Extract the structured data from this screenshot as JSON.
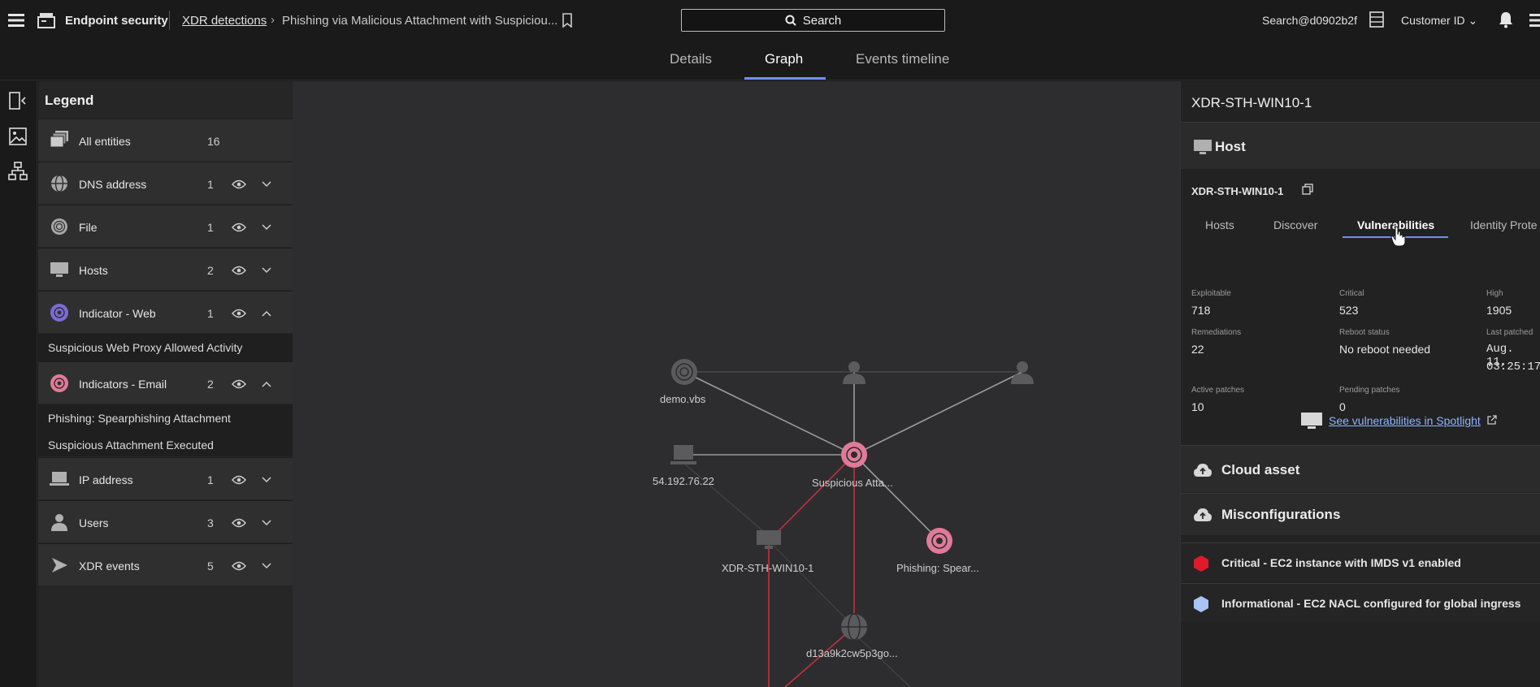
{
  "header": {
    "app_name": "Endpoint security",
    "breadcrumb_link": "XDR detections",
    "breadcrumb_current": "Phishing via Malicious Attachment with Suspiciou...",
    "search_label": "Search",
    "user": "Search@d0902b2f",
    "customer": "Customer ID"
  },
  "tabs": [
    "Details",
    "Graph",
    "Events timeline"
  ],
  "legend": {
    "title": "Legend",
    "all_entities": {
      "label": "All entities",
      "count": "16"
    },
    "rows": [
      {
        "label": "DNS address",
        "count": "1",
        "icon": "globe-icon"
      },
      {
        "label": "File",
        "count": "1",
        "icon": "fingerprint-icon"
      },
      {
        "label": "Hosts",
        "count": "2",
        "icon": "monitor-icon"
      },
      {
        "label": "Indicator - Web",
        "count": "1",
        "icon": "web-indicator-icon"
      },
      {
        "label": "Indicators - Email",
        "count": "2",
        "icon": "email-indicator-icon"
      },
      {
        "label": "IP address",
        "count": "1",
        "icon": "laptop-icon"
      },
      {
        "label": "Users",
        "count": "3",
        "icon": "user-icon"
      },
      {
        "label": "XDR events",
        "count": "5",
        "icon": "arrow-icon"
      }
    ],
    "web_items": [
      "Suspicious Web Proxy Allowed Activity"
    ],
    "email_items": [
      "Phishing: Spearphishing Attachment",
      "Suspicious Attachment Executed"
    ]
  },
  "graph": {
    "nodes": {
      "demo": "demo.vbs",
      "ip": "54.192.76.22",
      "susp": "Suspicious Atta...",
      "host": "XDR-STH-WIN10-1",
      "phish": "Phishing: Spear...",
      "dns": "d13a9k2cw5p3go..."
    }
  },
  "panel": {
    "title": "XDR-STH-WIN10-1",
    "host_section": "Host",
    "host_name": "XDR-STH-WIN10-1",
    "tabs": [
      "Hosts",
      "Discover",
      "Vulnerabilities",
      "Identity Prote"
    ],
    "stats": {
      "exploitable_label": "Exploitable",
      "exploitable": "718",
      "critical_label": "Critical",
      "critical": "523",
      "high_label": "High",
      "high": "1905",
      "remediations_label": "Remediations",
      "remediations": "22",
      "reboot_label": "Reboot status",
      "reboot": "No reboot needed",
      "last_patched_label": "Last patched",
      "last_patched_1": "Aug. 11,",
      "last_patched_2": "03:25:17",
      "active_label": "Active patches",
      "active": "10",
      "pending_label": "Pending patches",
      "pending": "0"
    },
    "spotlight_link": "See vulnerabilities in Spotlight",
    "cloud_section": "Cloud asset",
    "misconfig_section": "Misconfigurations",
    "misconfigs": [
      {
        "text": "Critical - EC2 instance with IMDS v1 enabled",
        "color": "#e0192b"
      },
      {
        "text": "Informational - EC2 NACL configured for global ingress",
        "color": "#a9c4f5"
      }
    ]
  }
}
